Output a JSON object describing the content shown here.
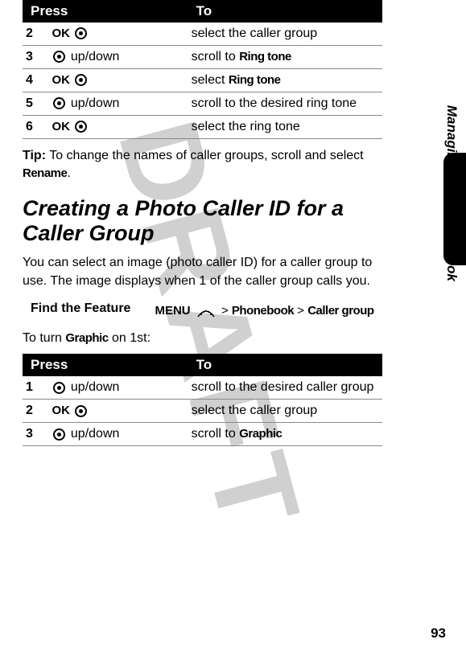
{
  "watermark": "DRAFT",
  "side_label": "Managing Your Phonebook",
  "page_number": "93",
  "table1": {
    "headers": {
      "press": "Press",
      "to": "To"
    },
    "rows": [
      {
        "num": "2",
        "key": "OK",
        "icon": "ring",
        "desc": "select the caller group"
      },
      {
        "num": "3",
        "key": "",
        "icon": "ring",
        "suffix": "up/down",
        "desc_prefix": "scroll to ",
        "desc_bold": "Ring tone"
      },
      {
        "num": "4",
        "key": "OK",
        "icon": "ring",
        "desc_prefix": "select ",
        "desc_bold": "Ring tone"
      },
      {
        "num": "5",
        "key": "",
        "icon": "ring",
        "suffix": "up/down",
        "desc": "scroll to the desired ring tone"
      },
      {
        "num": "6",
        "key": "OK",
        "icon": "ring",
        "desc": "select the ring tone"
      }
    ]
  },
  "tip": {
    "label": "Tip:",
    "text_before": " To change the names of caller groups, scroll and select ",
    "bold": "Rename",
    "text_after": "."
  },
  "heading": "Creating a Photo Caller ID for a Caller Group",
  "paragraph": "You can select an image (photo caller ID) for a caller group to use. The image displays when 1 of the caller group calls you.",
  "find_feature": {
    "label": "Find the Feature",
    "menu": "MENU",
    "sep": ">",
    "path1": "Phonebook",
    "path2": "Caller group"
  },
  "turn_on": {
    "prefix": "To turn ",
    "bold": "Graphic",
    "suffix": " on 1st:"
  },
  "table2": {
    "headers": {
      "press": "Press",
      "to": "To"
    },
    "rows": [
      {
        "num": "1",
        "key": "",
        "icon": "ring",
        "suffix": "up/down",
        "desc": "scroll to the desired caller group"
      },
      {
        "num": "2",
        "key": "OK",
        "icon": "ring",
        "desc": "select the caller group"
      },
      {
        "num": "3",
        "key": "",
        "icon": "ring",
        "suffix": "up/down",
        "desc_prefix": "scroll to ",
        "desc_bold": "Graphic"
      }
    ]
  }
}
